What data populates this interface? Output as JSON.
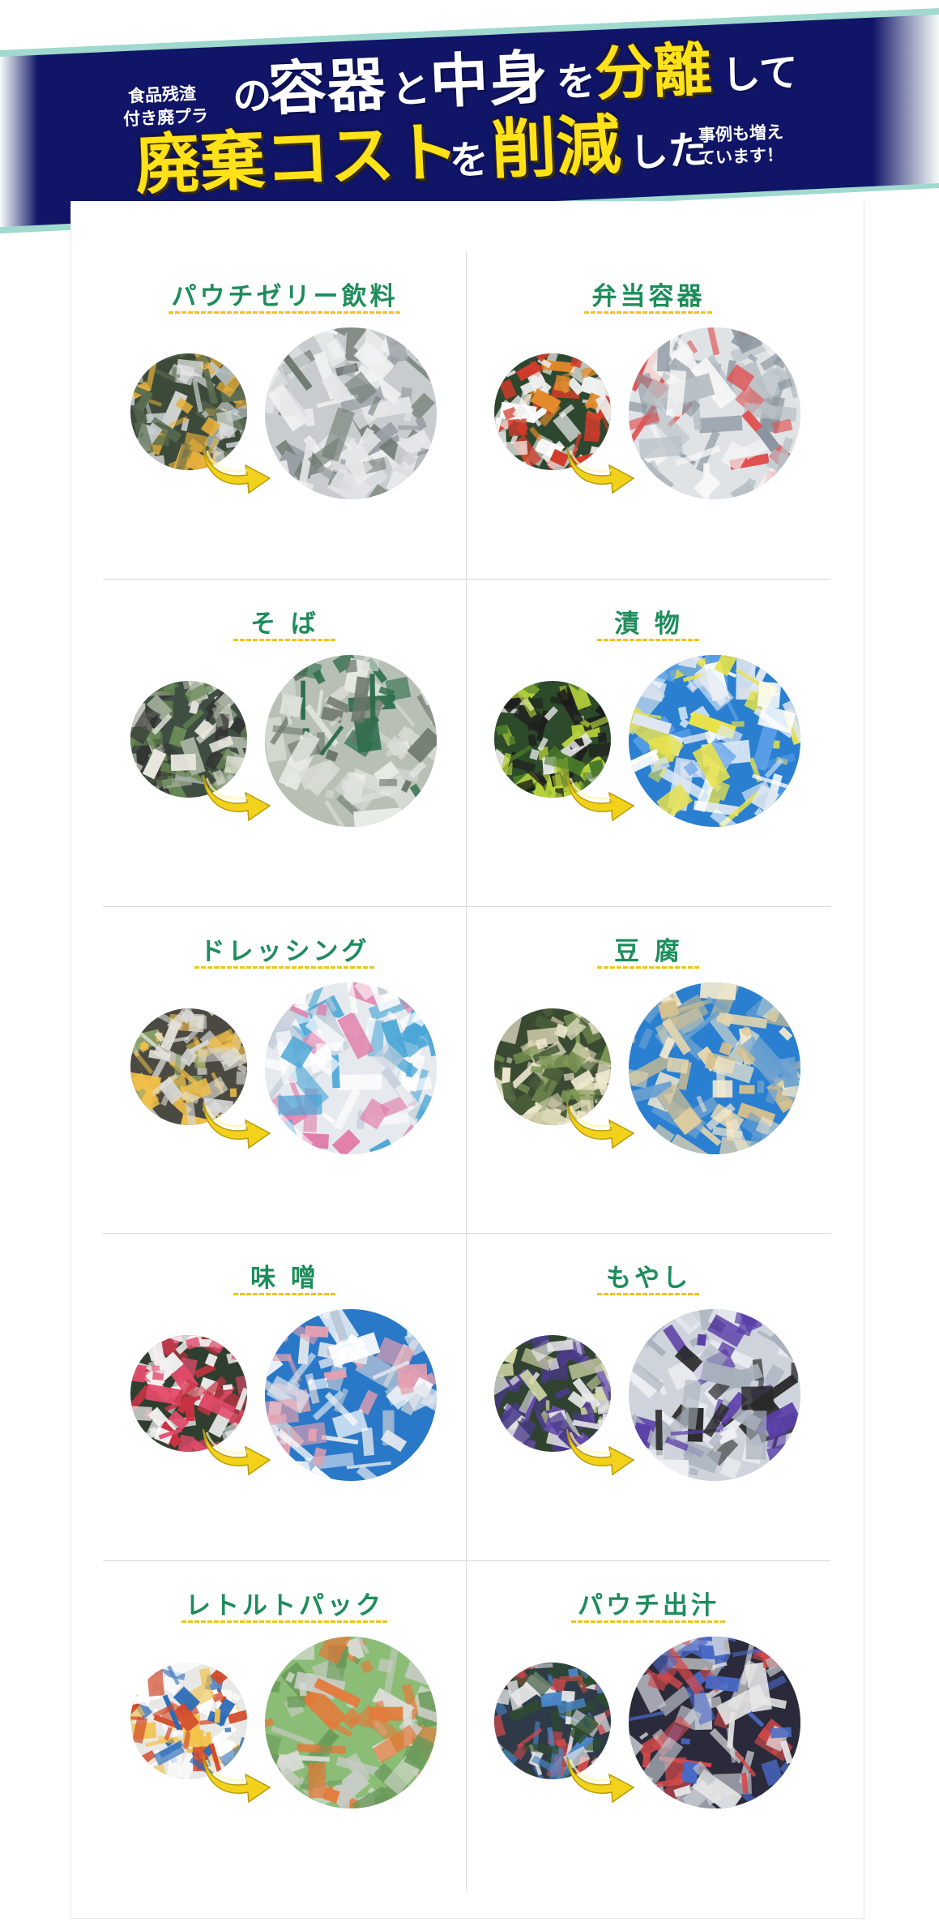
{
  "banner": {
    "small_left_line1": "食品残渣",
    "small_left_line2": "付き廃プラ",
    "line1": [
      {
        "t": "の",
        "cls": "mid"
      },
      {
        "t": "容器",
        "cls": "big"
      },
      {
        "t": "と",
        "cls": "mid"
      },
      {
        "t": "中身",
        "cls": "big"
      },
      {
        "t": "を",
        "cls": "mid"
      },
      {
        "t": "分離",
        "cls": "big-yellow"
      },
      {
        "t": "して",
        "cls": "mid"
      }
    ],
    "line2_yellow": "廃棄コスト",
    "line2_wo": "を",
    "line2_yellow2": "削減",
    "line2_rest": "した",
    "small_right_line1": "事例も増え",
    "small_right_line2": "ています！",
    "colors": {
      "navy": "#101567",
      "teal": "#8fd2c6",
      "yellow": "#ffe21a"
    }
  },
  "cases": [
    {
      "label": "パウチゼリー飲料",
      "before_icon": "pouch-jelly-photo",
      "after_icon": "shredded-silver-plastic-photo"
    },
    {
      "label": "弁当容器",
      "before_icon": "bento-container-photo",
      "after_icon": "shredded-clear-plastic-photo"
    },
    {
      "label": "そ ば",
      "before_icon": "soba-package-photo",
      "after_icon": "shredded-green-plastic-photo"
    },
    {
      "label": "漬 物",
      "before_icon": "pickles-container-photo",
      "after_icon": "shredded-yellow-plastic-photo"
    },
    {
      "label": "ドレッシング",
      "before_icon": "dressing-bottle-photo",
      "after_icon": "shredded-blue-pink-plastic-photo"
    },
    {
      "label": "豆 腐",
      "before_icon": "tofu-pack-photo",
      "after_icon": "shredded-beige-plastic-photo"
    },
    {
      "label": "味 噌",
      "before_icon": "miso-container-photo",
      "after_icon": "shredded-pink-plastic-photo"
    },
    {
      "label": "もやし",
      "before_icon": "bean-sprout-bag-photo",
      "after_icon": "shredded-purple-film-photo"
    },
    {
      "label": "レトルトパック",
      "before_icon": "retort-pouch-photo",
      "after_icon": "shredded-foil-green-photo"
    },
    {
      "label": "パウチ出汁",
      "before_icon": "dashi-pouch-photo",
      "after_icon": "shredded-foil-dark-photo"
    }
  ],
  "colors": {
    "title_green": "#1e8c5c",
    "arrow_yellow": "#f2d21a",
    "divider": "#d9d9d9"
  }
}
